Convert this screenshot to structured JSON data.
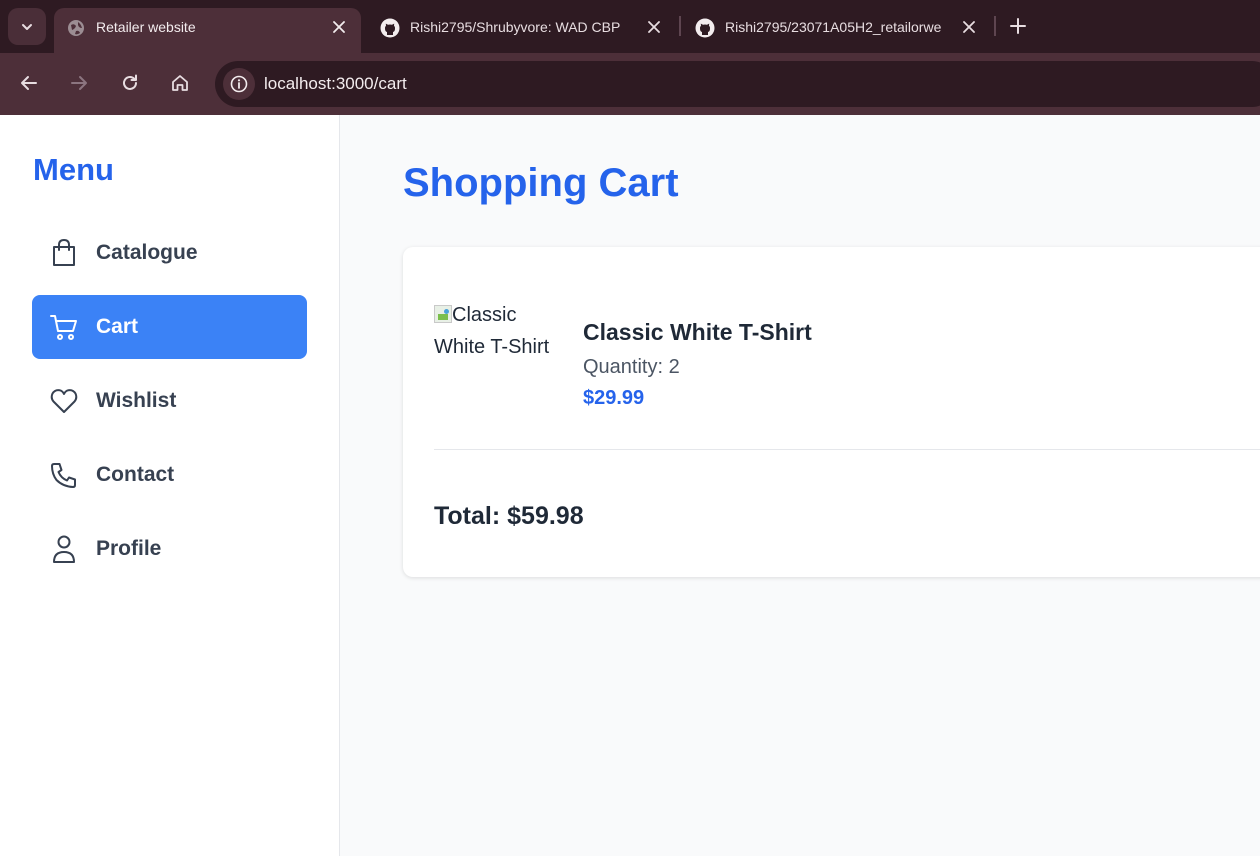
{
  "browser": {
    "tabs": [
      {
        "title": "Retailer website",
        "active": true
      },
      {
        "title": "Rishi2795/Shrubyvore: WAD CBP",
        "active": false
      },
      {
        "title": "Rishi2795/23071A05H2_retailorwe",
        "active": false
      }
    ],
    "url": "localhost:3000/cart"
  },
  "sidebar": {
    "title": "Menu",
    "items": [
      {
        "label": "Catalogue",
        "icon": "shopping-bag-icon",
        "active": false
      },
      {
        "label": "Cart",
        "icon": "shopping-cart-icon",
        "active": true
      },
      {
        "label": "Wishlist",
        "icon": "heart-icon",
        "active": false
      },
      {
        "label": "Contact",
        "icon": "phone-icon",
        "active": false
      },
      {
        "label": "Profile",
        "icon": "user-icon",
        "active": false
      }
    ]
  },
  "cart": {
    "title": "Shopping Cart",
    "items": [
      {
        "image_alt": "Classic White T-Shirt",
        "name": "Classic White T-Shirt",
        "quantity_text": "Quantity: 2",
        "price": "$29.99"
      }
    ],
    "total_text": "Total: $59.98"
  },
  "colors": {
    "accent": "#2563eb",
    "active_nav": "#3b82f6",
    "chrome_dark": "#2e1a22",
    "chrome_mid": "#4d2f39"
  }
}
